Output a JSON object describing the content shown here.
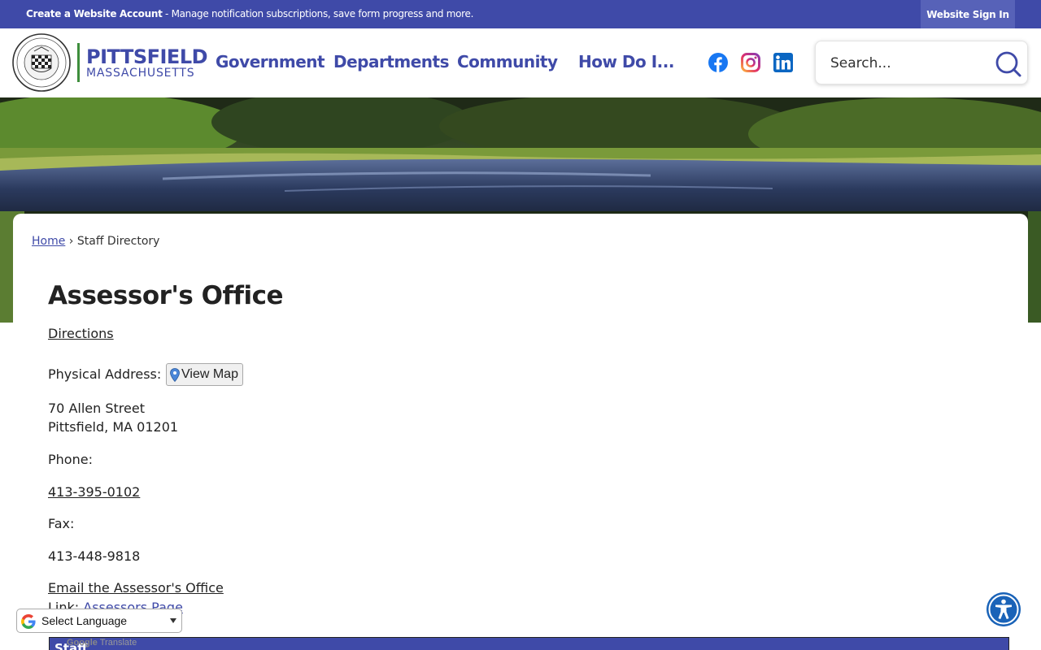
{
  "topbar": {
    "promo_bold": "Create a Website Account",
    "promo_text": " - Manage notification subscriptions, save form progress and more.",
    "signin_label": "Website Sign In"
  },
  "header": {
    "logo_name": "PITTSFIELD",
    "logo_state": "MASSACHUSETTS",
    "nav": [
      "Government",
      "Departments",
      "Community",
      "How Do I..."
    ],
    "social": [
      "facebook-icon",
      "instagram-icon",
      "linkedin-icon"
    ],
    "search_placeholder": "Search..."
  },
  "breadcrumb": {
    "home": "Home",
    "separator": "›",
    "current": "Staff Directory"
  },
  "main": {
    "title": "Assessor's Office",
    "directions_label": "Directions",
    "physical_address_label": "Physical Address:",
    "view_map_label": "View Map",
    "address_line1": "70 Allen Street",
    "address_line2": "Pittsfield, MA 01201",
    "phone_label": "Phone:",
    "phone_value": "413-395-0102",
    "fax_label": "Fax:",
    "fax_value": "413-448-9818",
    "email_label": "Email the Assessor's Office",
    "link_label": "Link: ",
    "link_value": "Assessors Page",
    "staff_heading": "Staff"
  },
  "translate": {
    "selected": "Select Language",
    "powered_google": "Google",
    "powered_translate": "Translate"
  },
  "colors": {
    "brand_blue": "#3f4aa8",
    "accessibility_blue": "#1a63b8",
    "logo_green": "#3e8e3c"
  }
}
